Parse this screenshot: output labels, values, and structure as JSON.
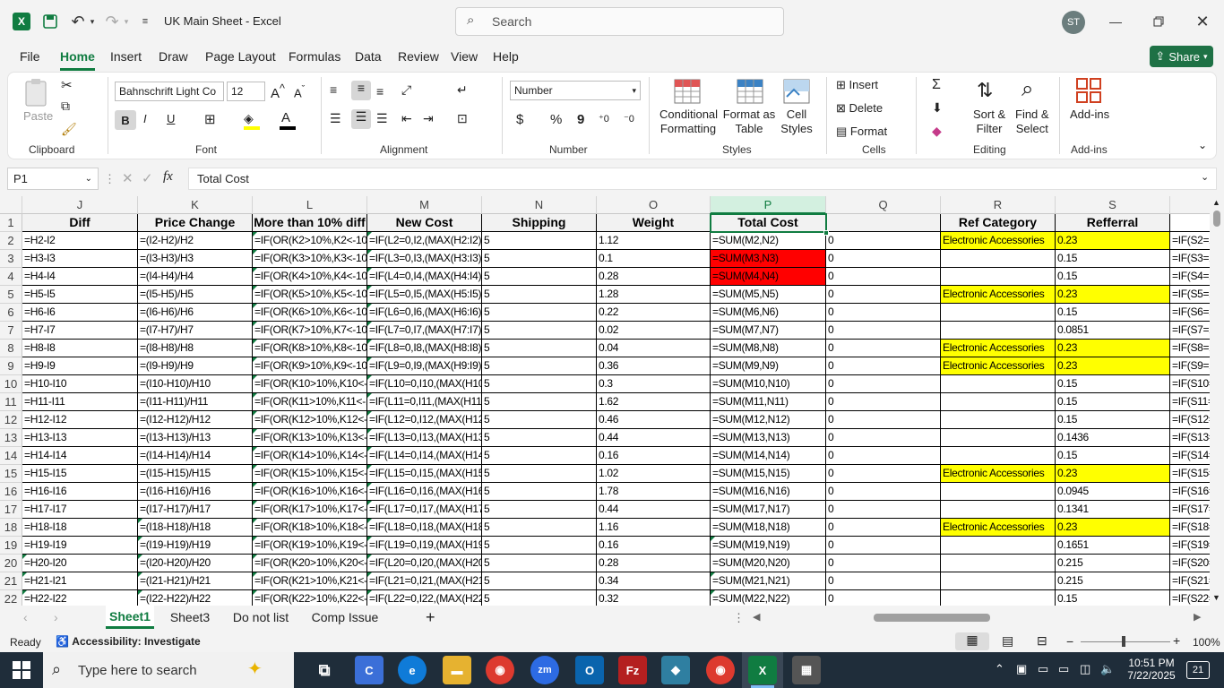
{
  "title_bar": {
    "doc_title": "UK Main Sheet  -  Excel",
    "search_placeholder": "Search",
    "user_initials": "ST"
  },
  "menu": {
    "items": [
      "File",
      "Home",
      "Insert",
      "Draw",
      "Page Layout",
      "Formulas",
      "Data",
      "Review",
      "View",
      "Help"
    ],
    "active": "Home",
    "share_label": "Share"
  },
  "ribbon": {
    "clipboard": {
      "paste": "Paste",
      "group": "Clipboard"
    },
    "font": {
      "name": "Bahnschrift Light Co",
      "size": "12",
      "group": "Font",
      "bold": "B",
      "italic": "I",
      "underline": "U"
    },
    "alignment": {
      "group": "Alignment"
    },
    "number": {
      "format": "Number",
      "group": "Number",
      "currency": "$",
      "percent": "%",
      "comma": "9"
    },
    "styles": {
      "conditional_1": "Conditional",
      "conditional_2": "Formatting",
      "format_table_1": "Format as",
      "format_table_2": "Table",
      "cell_styles_1": "Cell",
      "cell_styles_2": "Styles",
      "group": "Styles"
    },
    "cells": {
      "insert": "Insert",
      "delete": "Delete",
      "format": "Format",
      "group": "Cells"
    },
    "editing": {
      "sort_1": "Sort &",
      "sort_2": "Filter",
      "find_1": "Find &",
      "find_2": "Select",
      "group": "Editing",
      "sum": "Σ"
    },
    "addins": {
      "label": "Add-ins",
      "group": "Add-ins"
    }
  },
  "formula_bar": {
    "name_box": "P1",
    "formula": "Total Cost",
    "fx": "fx"
  },
  "columns": [
    "J",
    "K",
    "L",
    "M",
    "N",
    "O",
    "P",
    "Q",
    "R",
    "S"
  ],
  "headers": {
    "J": "Diff",
    "K": "Price Change",
    "L": "More than 10% diff",
    "M": "New Cost",
    "N": "Shipping",
    "O": "Weight",
    "P": "Total Cost",
    "Q": "",
    "R": "Ref Category",
    "S": "Refferral"
  },
  "rows": [
    {
      "n": 2,
      "J": "=H2-I2",
      "K": "=(I2-H2)/H2",
      "L": "=IF(OR(K2>10%,K2<-10%),1,",
      "M": "=IF(L2=0,I2,(MAX(H2:I2)))",
      "N": "5",
      "O": "1.12",
      "P": "=SUM(M2,N2)",
      "Q": "0",
      "R": "Electronic Accessories",
      "S": "0.23",
      "T": "=IF(S2=2"
    },
    {
      "n": 3,
      "J": "=H3-I3",
      "K": "=(I3-H3)/H3",
      "L": "=IF(OR(K3>10%,K3<-10%),1,",
      "M": "=IF(L3=0,I3,(MAX(H3:I3)))",
      "N": "5",
      "O": "0.1",
      "P": "=SUM(M3,N3)",
      "Q": "0",
      "R": "",
      "S": "0.15",
      "T": "=IF(S3=2"
    },
    {
      "n": 4,
      "J": "=H4-I4",
      "K": "=(I4-H4)/H4",
      "L": "=IF(OR(K4>10%,K4<-10%),1,",
      "M": "=IF(L4=0,I4,(MAX(H4:I4)))",
      "N": "5",
      "O": "0.28",
      "P": "=SUM(M4,N4)",
      "Q": "0",
      "R": "",
      "S": "0.15",
      "T": "=IF(S4=2"
    },
    {
      "n": 5,
      "J": "=H5-I5",
      "K": "=(I5-H5)/H5",
      "L": "=IF(OR(K5>10%,K5<-10%),1,",
      "M": "=IF(L5=0,I5,(MAX(H5:I5)))",
      "N": "5",
      "O": "1.28",
      "P": "=SUM(M5,N5)",
      "Q": "0",
      "R": "Electronic Accessories",
      "S": "0.23",
      "T": "=IF(S5=2"
    },
    {
      "n": 6,
      "J": "=H6-I6",
      "K": "=(I6-H6)/H6",
      "L": "=IF(OR(K6>10%,K6<-10%),1,",
      "M": "=IF(L6=0,I6,(MAX(H6:I6)))",
      "N": "5",
      "O": "0.22",
      "P": "=SUM(M6,N6)",
      "Q": "0",
      "R": "",
      "S": "0.15",
      "T": "=IF(S6=2"
    },
    {
      "n": 7,
      "J": "=H7-I7",
      "K": "=(I7-H7)/H7",
      "L": "=IF(OR(K7>10%,K7<-10%),1,",
      "M": "=IF(L7=0,I7,(MAX(H7:I7)))",
      "N": "5",
      "O": "0.02",
      "P": "=SUM(M7,N7)",
      "Q": "0",
      "R": "",
      "S": "0.0851",
      "T": "=IF(S7=2"
    },
    {
      "n": 8,
      "J": "=H8-I8",
      "K": "=(I8-H8)/H8",
      "L": "=IF(OR(K8>10%,K8<-10%),1,",
      "M": "=IF(L8=0,I8,(MAX(H8:I8)))",
      "N": "5",
      "O": "0.04",
      "P": "=SUM(M8,N8)",
      "Q": "0",
      "R": "Electronic Accessories",
      "S": "0.23",
      "T": "=IF(S8=2"
    },
    {
      "n": 9,
      "J": "=H9-I9",
      "K": "=(I9-H9)/H9",
      "L": "=IF(OR(K9>10%,K9<-10%),1,",
      "M": "=IF(L9=0,I9,(MAX(H9:I9)))",
      "N": "5",
      "O": "0.36",
      "P": "=SUM(M9,N9)",
      "Q": "0",
      "R": "Electronic Accessories",
      "S": "0.23",
      "T": "=IF(S9=2"
    },
    {
      "n": 10,
      "J": "=H10-I10",
      "K": "=(I10-H10)/H10",
      "L": "=IF(OR(K10>10%,K10<-10%),",
      "M": "=IF(L10=0,I10,(MAX(H10:I10)))",
      "N": "5",
      "O": "0.3",
      "P": "=SUM(M10,N10)",
      "Q": "0",
      "R": "",
      "S": "0.15",
      "T": "=IF(S10="
    },
    {
      "n": 11,
      "J": "=H11-I11",
      "K": "=(I11-H11)/H11",
      "L": "=IF(OR(K11>10%,K11<-10%),",
      "M": "=IF(L11=0,I11,(MAX(H11:I11)))",
      "N": "5",
      "O": "1.62",
      "P": "=SUM(M11,N11)",
      "Q": "0",
      "R": "",
      "S": "0.15",
      "T": "=IF(S11="
    },
    {
      "n": 12,
      "J": "=H12-I12",
      "K": "=(I12-H12)/H12",
      "L": "=IF(OR(K12>10%,K12<-10%),",
      "M": "=IF(L12=0,I12,(MAX(H12:I12)))",
      "N": "5",
      "O": "0.46",
      "P": "=SUM(M12,N12)",
      "Q": "0",
      "R": "",
      "S": "0.15",
      "T": "=IF(S12="
    },
    {
      "n": 13,
      "J": "=H13-I13",
      "K": "=(I13-H13)/H13",
      "L": "=IF(OR(K13>10%,K13<-10%),",
      "M": "=IF(L13=0,I13,(MAX(H13:I13)))",
      "N": "5",
      "O": "0.44",
      "P": "=SUM(M13,N13)",
      "Q": "0",
      "R": "",
      "S": "0.1436",
      "T": "=IF(S13="
    },
    {
      "n": 14,
      "J": "=H14-I14",
      "K": "=(I14-H14)/H14",
      "L": "=IF(OR(K14>10%,K14<-10%),",
      "M": "=IF(L14=0,I14,(MAX(H14:I14)))",
      "N": "5",
      "O": "0.16",
      "P": "=SUM(M14,N14)",
      "Q": "0",
      "R": "",
      "S": "0.15",
      "T": "=IF(S14="
    },
    {
      "n": 15,
      "J": "=H15-I15",
      "K": "=(I15-H15)/H15",
      "L": "=IF(OR(K15>10%,K15<-10%),",
      "M": "=IF(L15=0,I15,(MAX(H15:I15)))",
      "N": "5",
      "O": "1.02",
      "P": "=SUM(M15,N15)",
      "Q": "0",
      "R": "Electronic Accessories",
      "S": "0.23",
      "T": "=IF(S15="
    },
    {
      "n": 16,
      "J": "=H16-I16",
      "K": "=(I16-H16)/H16",
      "L": "=IF(OR(K16>10%,K16<-10%),",
      "M": "=IF(L16=0,I16,(MAX(H16:I16)))",
      "N": "5",
      "O": "1.78",
      "P": "=SUM(M16,N16)",
      "Q": "0",
      "R": "",
      "S": "0.0945",
      "T": "=IF(S16="
    },
    {
      "n": 17,
      "J": "=H17-I17",
      "K": "=(I17-H17)/H17",
      "L": "=IF(OR(K17>10%,K17<-10%),",
      "M": "=IF(L17=0,I17,(MAX(H17:I17)))",
      "N": "5",
      "O": "0.44",
      "P": "=SUM(M17,N17)",
      "Q": "0",
      "R": "",
      "S": "0.1341",
      "T": "=IF(S17="
    },
    {
      "n": 18,
      "J": "=H18-I18",
      "K": "=(I18-H18)/H18",
      "L": "=IF(OR(K18>10%,K18<-10%),",
      "M": "=IF(L18=0,I18,(MAX(H18:I18)))",
      "N": "5",
      "O": "1.16",
      "P": "=SUM(M18,N18)",
      "Q": "0",
      "R": "Electronic Accessories",
      "S": "0.23",
      "T": "=IF(S18="
    },
    {
      "n": 19,
      "J": "=H19-I19",
      "K": "=(I19-H19)/H19",
      "L": "=IF(OR(K19>10%,K19<-10%),",
      "M": "=IF(L19=0,I19,(MAX(H19:I19)))",
      "N": "5",
      "O": "0.16",
      "P": "=SUM(M19,N19)",
      "Q": "0",
      "R": "",
      "S": "0.1651",
      "T": "=IF(S19="
    },
    {
      "n": 20,
      "J": "=H20-I20",
      "K": "=(I20-H20)/H20",
      "L": "=IF(OR(K20>10%,K20<-10%",
      "M": "=IF(L20=0,I20,(MAX(H20:I20",
      "N": "5",
      "O": "0.28",
      "P": "=SUM(M20,N20)",
      "Q": "0",
      "R": "",
      "S": "0.215",
      "T": "=IF(S20="
    },
    {
      "n": 21,
      "J": "=H21-I21",
      "K": "=(I21-H21)/H21",
      "L": "=IF(OR(K21>10%,K21<-10%),",
      "M": "=IF(L21=0,I21,(MAX(H21:I21)))",
      "N": "5",
      "O": "0.34",
      "P": "=SUM(M21,N21)",
      "Q": "0",
      "R": "",
      "S": "0.215",
      "T": "=IF(S21="
    },
    {
      "n": 22,
      "J": "=H22-I22",
      "K": "=(I22-H22)/H22",
      "L": "=IF(OR(K22>10%,K22<-10%",
      "M": "=IF(L22=0,I22,(MAX(H22:I22",
      "N": "5",
      "O": "0.32",
      "P": "=SUM(M22,N22)",
      "Q": "0",
      "R": "",
      "S": "0.15",
      "T": "=IF(S22="
    }
  ],
  "sheet_tabs": [
    "Sheet1",
    "Sheet3",
    "Do not list",
    "Comp Issue"
  ],
  "active_sheet": "Sheet1",
  "status": {
    "mode": "Ready",
    "accessibility": "Accessibility: Investigate",
    "zoom": "100%"
  },
  "taskbar": {
    "search_placeholder": "Type here to search",
    "time": "10:51 PM",
    "date": "7/22/2025",
    "notifications": "21"
  },
  "colors": {
    "excel_green": "#107c41",
    "highlight_yellow": "#ffff00",
    "highlight_red": "#ff0000"
  }
}
